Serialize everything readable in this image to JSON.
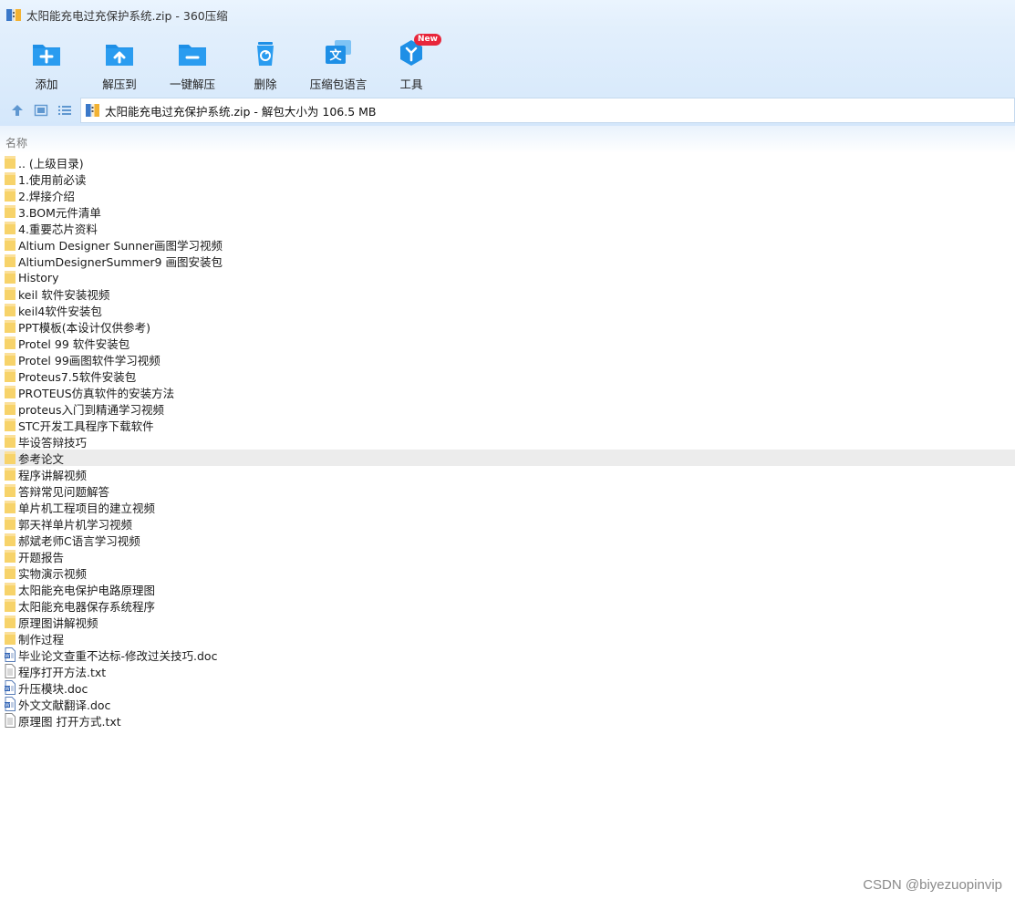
{
  "window": {
    "title": "太阳能充电过充保护系统.zip - 360压缩"
  },
  "toolbar": {
    "buttons": [
      {
        "label": "添加",
        "icon": "add-icon"
      },
      {
        "label": "解压到",
        "icon": "extract-to-icon"
      },
      {
        "label": "一键解压",
        "icon": "one-click-extract-icon"
      },
      {
        "label": "删除",
        "icon": "delete-icon"
      },
      {
        "label": "压缩包语言",
        "icon": "archive-language-icon"
      },
      {
        "label": "工具",
        "icon": "tools-icon",
        "badge": "New"
      }
    ]
  },
  "address": {
    "path": "太阳能充电过充保护系统.zip - 解包大小为 106.5 MB"
  },
  "columns": {
    "name": "名称"
  },
  "files": [
    {
      "name": ".. (上级目录)",
      "type": "folder"
    },
    {
      "name": "1.使用前必读",
      "type": "folder"
    },
    {
      "name": "2.焊接介绍",
      "type": "folder"
    },
    {
      "name": "3.BOM元件清单",
      "type": "folder"
    },
    {
      "name": "4.重要芯片资料",
      "type": "folder"
    },
    {
      "name": "Altium Designer Sunner画图学习视频",
      "type": "folder"
    },
    {
      "name": "AltiumDesignerSummer9 画图安装包",
      "type": "folder"
    },
    {
      "name": "History",
      "type": "folder"
    },
    {
      "name": "keil 软件安装视频",
      "type": "folder"
    },
    {
      "name": "keil4软件安装包",
      "type": "folder"
    },
    {
      "name": "PPT模板(本设计仅供参考)",
      "type": "folder"
    },
    {
      "name": "Protel 99 软件安装包",
      "type": "folder"
    },
    {
      "name": "Protel 99画图软件学习视频",
      "type": "folder"
    },
    {
      "name": "Proteus7.5软件安装包",
      "type": "folder"
    },
    {
      "name": "PROTEUS仿真软件的安装方法",
      "type": "folder"
    },
    {
      "name": "proteus入门到精通学习视频",
      "type": "folder"
    },
    {
      "name": "STC开发工具程序下载软件",
      "type": "folder"
    },
    {
      "name": "毕设答辩技巧",
      "type": "folder"
    },
    {
      "name": "参考论文",
      "type": "folder",
      "highlighted": true
    },
    {
      "name": "程序讲解视频",
      "type": "folder"
    },
    {
      "name": "答辩常见问题解答",
      "type": "folder"
    },
    {
      "name": "单片机工程项目的建立视频",
      "type": "folder"
    },
    {
      "name": "郭天祥单片机学习视频",
      "type": "folder"
    },
    {
      "name": "郝斌老师C语言学习视频",
      "type": "folder"
    },
    {
      "name": "开题报告",
      "type": "folder"
    },
    {
      "name": "实物演示视频",
      "type": "folder"
    },
    {
      "name": "太阳能充电保护电路原理图",
      "type": "folder"
    },
    {
      "name": "太阳能充电器保存系统程序",
      "type": "folder"
    },
    {
      "name": "原理图讲解视频",
      "type": "folder"
    },
    {
      "name": "制作过程",
      "type": "folder"
    },
    {
      "name": "毕业论文查重不达标-修改过关技巧.doc",
      "type": "doc"
    },
    {
      "name": "程序打开方法.txt",
      "type": "txt"
    },
    {
      "name": "升压模块.doc",
      "type": "doc"
    },
    {
      "name": "外文文献翻译.doc",
      "type": "doc"
    },
    {
      "name": "原理图 打开方式.txt",
      "type": "txt"
    }
  ],
  "watermark": "CSDN @biyezuopinvip",
  "colors": {
    "accent": "#1e8fe6",
    "folder": "#f7d36a",
    "badge": "#e8263b"
  }
}
